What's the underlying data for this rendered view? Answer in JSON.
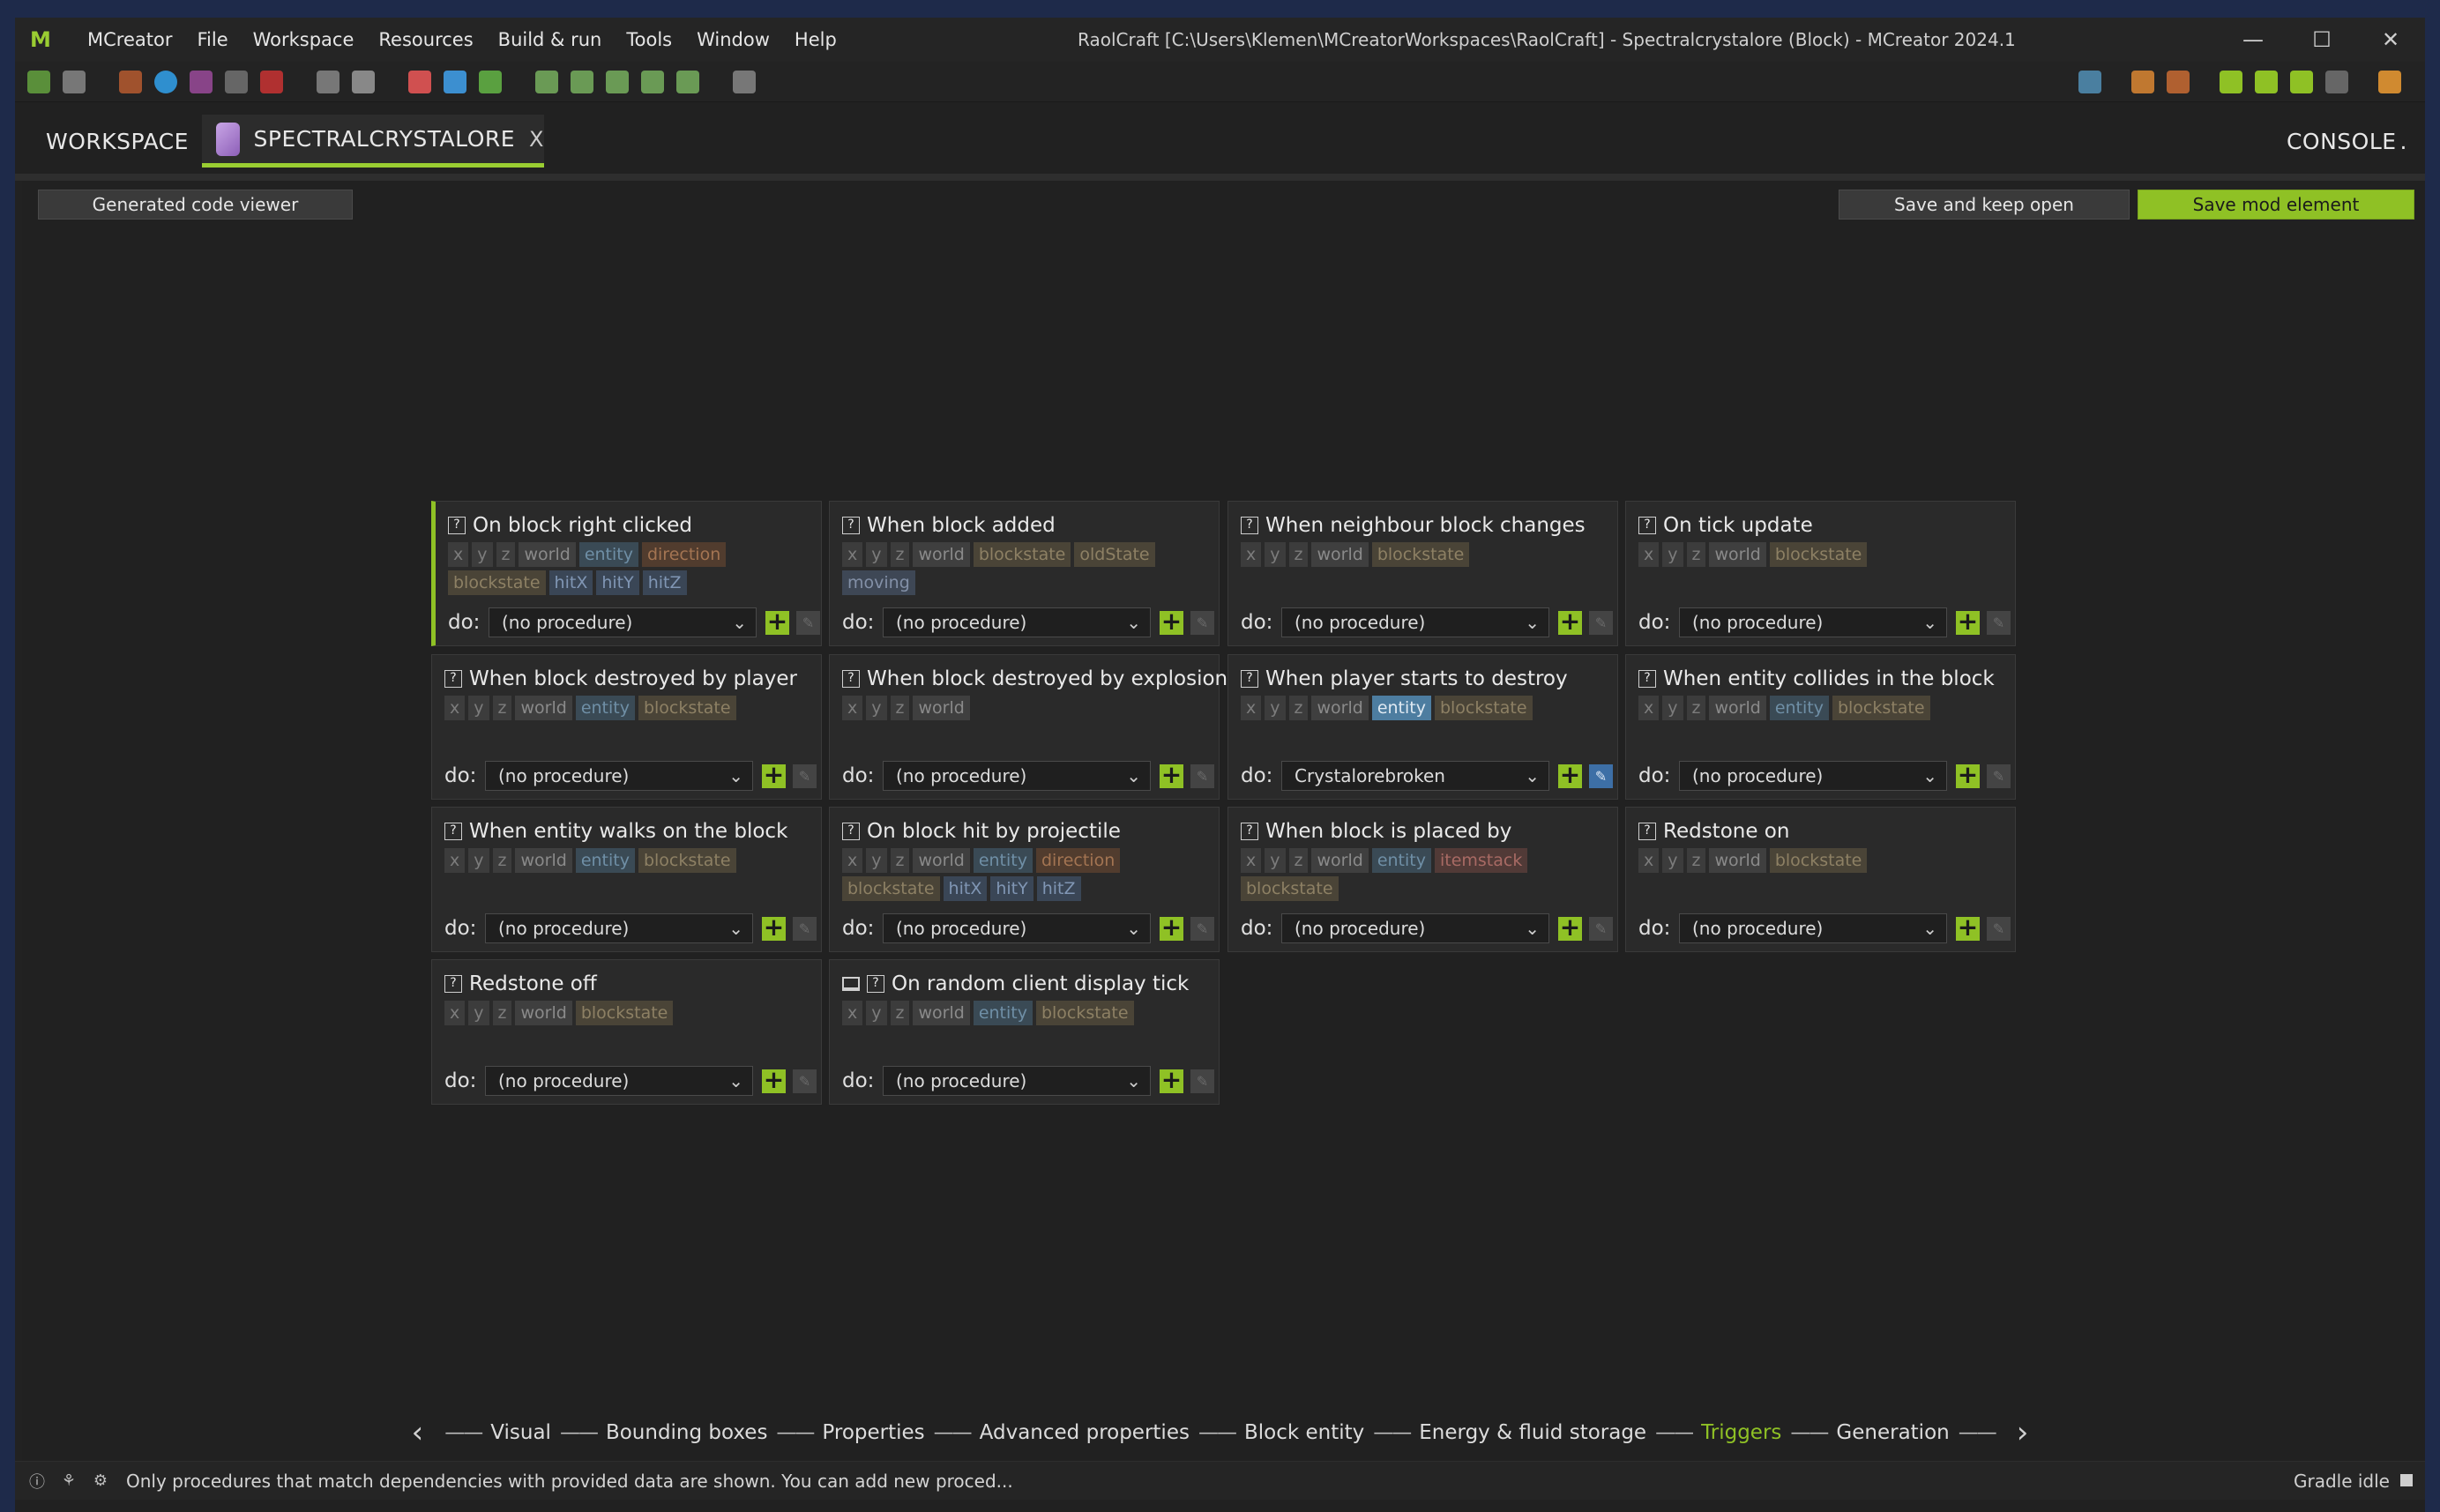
{
  "app": {
    "name": "MCreator",
    "window_title": "RaolCraft [C:\\Users\\Klemen\\MCreatorWorkspaces\\RaolCraft] - Spectralcrystalore (Block) - MCreator 2024.1"
  },
  "menu": [
    "File",
    "Workspace",
    "Resources",
    "Build & run",
    "Tools",
    "Window",
    "Help"
  ],
  "window_controls": {
    "minimize": "—",
    "maximize": "☐",
    "close": "✕"
  },
  "tabs": {
    "workspace": "WORKSPACE",
    "block": "SPECTRALCRYSTALORE",
    "close": "X",
    "console": "CONSOLE"
  },
  "buttons": {
    "generated_code": "Generated code viewer",
    "save_keep_open": "Save and keep open",
    "save_mod_element": "Save mod element"
  },
  "do_label": "do:",
  "triggers": [
    {
      "title": "On block right clicked",
      "deps": [
        "x",
        "y",
        "z",
        "world",
        "entity",
        "direction",
        "blockstate",
        "hitX",
        "hitY",
        "hitZ"
      ],
      "procedure": "(no procedure)"
    },
    {
      "title": "When block added",
      "deps": [
        "x",
        "y",
        "z",
        "world",
        "blockstate",
        "oldState",
        "moving"
      ],
      "procedure": "(no procedure)"
    },
    {
      "title": "When neighbour block changes",
      "deps": [
        "x",
        "y",
        "z",
        "world",
        "blockstate"
      ],
      "procedure": "(no procedure)"
    },
    {
      "title": "On tick update",
      "deps": [
        "x",
        "y",
        "z",
        "world",
        "blockstate"
      ],
      "procedure": "(no procedure)"
    },
    {
      "title": "When block destroyed by player",
      "deps": [
        "x",
        "y",
        "z",
        "world",
        "entity",
        "blockstate"
      ],
      "procedure": "(no procedure)"
    },
    {
      "title": "When block destroyed by explosion",
      "deps": [
        "x",
        "y",
        "z",
        "world"
      ],
      "procedure": "(no procedure)"
    },
    {
      "title": "When player starts to destroy",
      "deps": [
        "x",
        "y",
        "z",
        "world",
        "entity",
        "blockstate"
      ],
      "procedure": "Crystalorebroken"
    },
    {
      "title": "When entity collides in the block",
      "deps": [
        "x",
        "y",
        "z",
        "world",
        "entity",
        "blockstate"
      ],
      "procedure": "(no procedure)"
    },
    {
      "title": "When entity walks on the block",
      "deps": [
        "x",
        "y",
        "z",
        "world",
        "entity",
        "blockstate"
      ],
      "procedure": "(no procedure)"
    },
    {
      "title": "On block hit by projectile",
      "deps": [
        "x",
        "y",
        "z",
        "world",
        "entity",
        "direction",
        "blockstate",
        "hitX",
        "hitY",
        "hitZ"
      ],
      "procedure": "(no procedure)"
    },
    {
      "title": "When block is placed by",
      "deps": [
        "x",
        "y",
        "z",
        "world",
        "entity",
        "itemstack",
        "blockstate"
      ],
      "procedure": "(no procedure)"
    },
    {
      "title": "Redstone on",
      "deps": [
        "x",
        "y",
        "z",
        "world",
        "blockstate"
      ],
      "procedure": "(no procedure)"
    },
    {
      "title": "Redstone off",
      "deps": [
        "x",
        "y",
        "z",
        "world",
        "blockstate"
      ],
      "procedure": "(no procedure)"
    },
    {
      "title": "On random client display tick",
      "deps": [
        "x",
        "y",
        "z",
        "world",
        "entity",
        "blockstate"
      ],
      "procedure": "(no procedure)"
    }
  ],
  "steps": [
    "Visual",
    "Bounding boxes",
    "Properties",
    "Advanced properties",
    "Block entity",
    "Energy & fluid storage",
    "Triggers",
    "Generation"
  ],
  "current_step": "Triggers",
  "status": {
    "message": "Only procedures that match dependencies with provided data are shown. You can add new proced...",
    "gradle": "Gradle idle"
  }
}
